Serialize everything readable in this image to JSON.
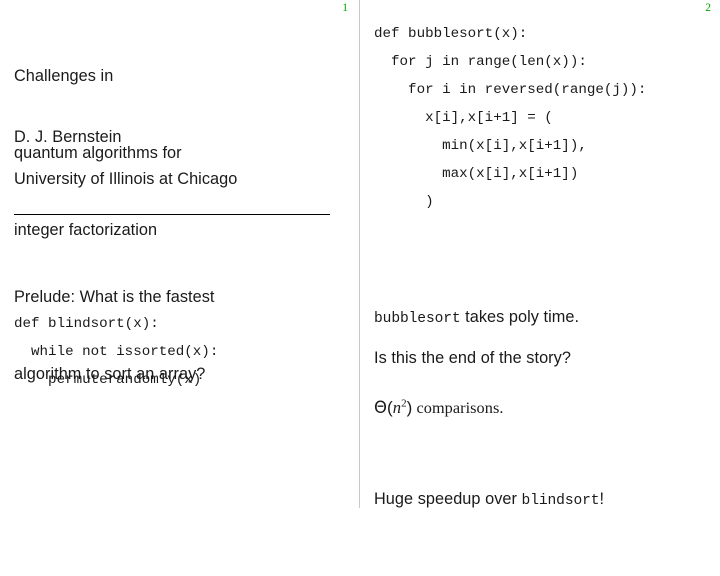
{
  "document": {
    "kind": "beamer-handout-2up",
    "accent_page_number_color": "#00a400",
    "rule_color": "#000000",
    "divider_color": "#c9c9c9"
  },
  "slides": [
    {
      "page_number": "1",
      "title_lines": [
        "Challenges in",
        "quantum algorithms for",
        "integer factorization"
      ],
      "author": "D. J. Bernstein",
      "affiliation": "University of Illinois at Chicago",
      "prelude_lines": [
        "Prelude: What is the fastest",
        "algorithm to sort an array?"
      ],
      "code": "def blindsort(x):\n  while not issorted(x):\n    permuterandomly(x)"
    },
    {
      "page_number": "2",
      "code": "def bubblesort(x):\n  for j in range(len(x)):\n    for i in reversed(range(j)):\n      x[i],x[i+1] = (\n        min(x[i],x[i+1]),\n        max(x[i],x[i+1])\n      )",
      "notes": {
        "line1_code": "bubblesort",
        "line1_text": " takes poly time.",
        "line2_theta": "Θ",
        "line2_open": "(",
        "line2_var": "n",
        "line2_sup": "2",
        "line2_close": ")",
        "line2_text": " comparisons.",
        "line3_pre": "Huge speedup over ",
        "line3_code": "blindsort",
        "line3_post": "!"
      },
      "question": "Is this the end of the story?"
    }
  ]
}
